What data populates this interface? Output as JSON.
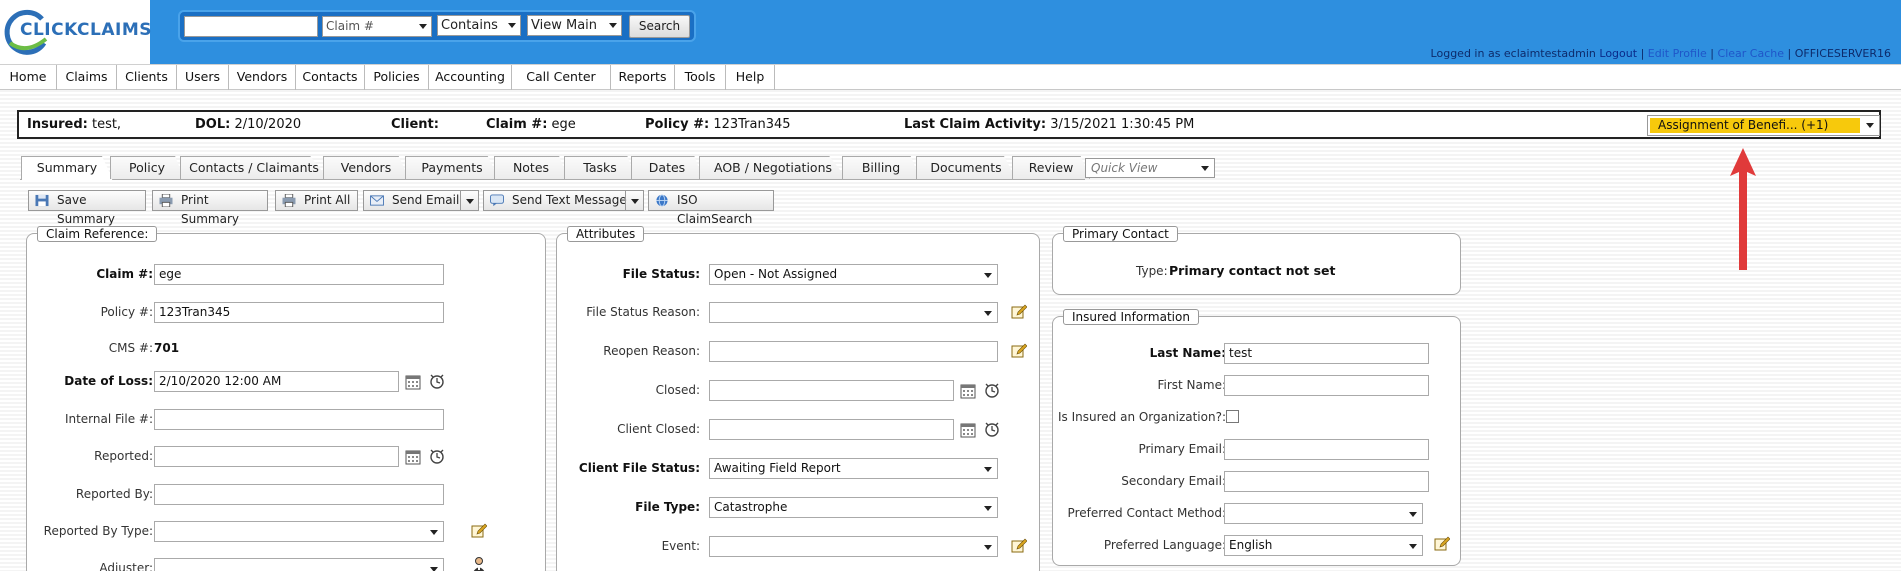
{
  "brand": {
    "name_part1": "CLICK",
    "name_part2": "CLAIMS"
  },
  "search": {
    "query": "",
    "field": "Claim #",
    "operator": "Contains",
    "view": "View Main",
    "button": "Search"
  },
  "user": {
    "logged_in_as": "Logged in as eclaimtestadmin",
    "logout": "Logout",
    "edit_profile": "Edit Profile",
    "clear_cache": "Clear Cache",
    "server": "OFFICESERVER16"
  },
  "menu": [
    "Home",
    "Claims",
    "Clients",
    "Users",
    "Vendors",
    "Contacts",
    "Policies",
    "Accounting",
    "Call Center",
    "Reports",
    "Tools",
    "Help"
  ],
  "infobar": {
    "insured_label": "Insured:",
    "insured_value": "test,",
    "dol_label": "DOL:",
    "dol_value": "2/10/2020",
    "client_label": "Client:",
    "client_value": "",
    "claim_label": "Claim #:",
    "claim_value": "ege",
    "policy_label": "Policy #:",
    "policy_value": "123Tran345",
    "activity_label": "Last Claim Activity:",
    "activity_value": "3/15/2021 1:30:45 PM",
    "aob_selected": "Assignment of Benefi... (+1)"
  },
  "tabs": [
    "Summary",
    "Policy",
    "Contacts / Claimants",
    "Vendors",
    "Payments",
    "Notes",
    "Tasks",
    "Dates",
    "AOB / Negotiations",
    "Billing",
    "Documents",
    "Review"
  ],
  "quick_view": "Quick View",
  "toolbar": {
    "save_summary": "Save Summary",
    "print_summary": "Print Summary",
    "print_all": "Print All",
    "send_email": "Send Email",
    "send_text": "Send Text Message",
    "iso": "ISO ClaimSearch"
  },
  "claim_reference": {
    "title": "Claim Reference:",
    "claim_label": "Claim #:",
    "claim_value": "ege",
    "policy_label": "Policy #:",
    "policy_value": "123Tran345",
    "cms_label": "CMS #:",
    "cms_value": "701",
    "dol_label": "Date of Loss:",
    "dol_value": "2/10/2020 12:00 AM",
    "internal_label": "Internal File #:",
    "internal_value": "",
    "reported_label": "Reported:",
    "reported_value": "",
    "reported_by_label": "Reported By:",
    "reported_by_value": "",
    "reported_by_type_label": "Reported By Type:",
    "reported_by_type_value": "",
    "adjuster_label": "Adjuster:",
    "adjuster_value": ""
  },
  "attributes": {
    "title": "Attributes",
    "file_status_label": "File Status:",
    "file_status_value": "Open - Not Assigned",
    "file_status_reason_label": "File Status Reason:",
    "file_status_reason_value": "",
    "reopen_reason_label": "Reopen Reason:",
    "reopen_reason_value": "",
    "closed_label": "Closed:",
    "closed_value": "",
    "client_closed_label": "Client Closed:",
    "client_closed_value": "",
    "client_file_status_label": "Client File Status:",
    "client_file_status_value": "Awaiting Field Report",
    "file_type_label": "File Type:",
    "file_type_value": "Catastrophe",
    "event_label": "Event:",
    "event_value": ""
  },
  "primary_contact": {
    "title": "Primary Contact",
    "type_label": "Type:",
    "type_value": "Primary contact not set"
  },
  "insured_info": {
    "title": "Insured Information",
    "last_name_label": "Last Name:",
    "last_name_value": "test",
    "first_name_label": "First Name:",
    "first_name_value": "",
    "org_label": "Is Insured an Organization?:",
    "primary_email_label": "Primary Email:",
    "primary_email_value": "",
    "secondary_email_label": "Secondary Email:",
    "secondary_email_value": "",
    "contact_method_label": "Preferred Contact Method:",
    "contact_method_value": "",
    "language_label": "Preferred Language:",
    "language_value": "English"
  },
  "colors": {
    "header_blue": "#2e8fdf",
    "aob_yellow": "#f7c90c",
    "arrow_red": "#e03a3a"
  }
}
